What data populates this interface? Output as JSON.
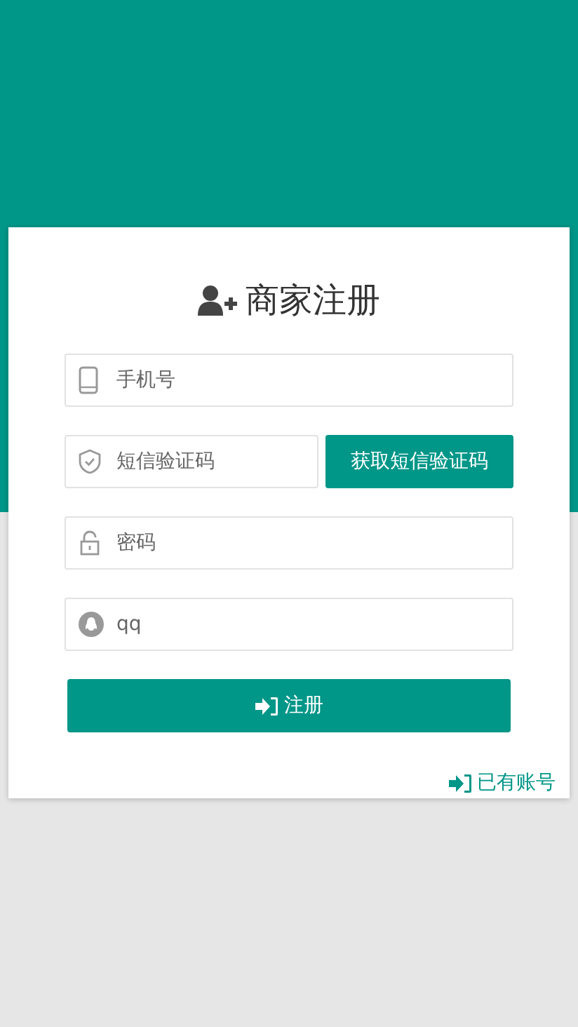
{
  "title": "商家注册",
  "fields": [
    {
      "kind": "phone",
      "placeholder": "手机号"
    },
    {
      "kind": "sms",
      "placeholder": "短信验证码",
      "button": "获取短信验证码"
    },
    {
      "kind": "password",
      "placeholder": "密码"
    },
    {
      "kind": "qq",
      "placeholder": "qq"
    }
  ],
  "submit": "注册",
  "login_link": "已有账号"
}
